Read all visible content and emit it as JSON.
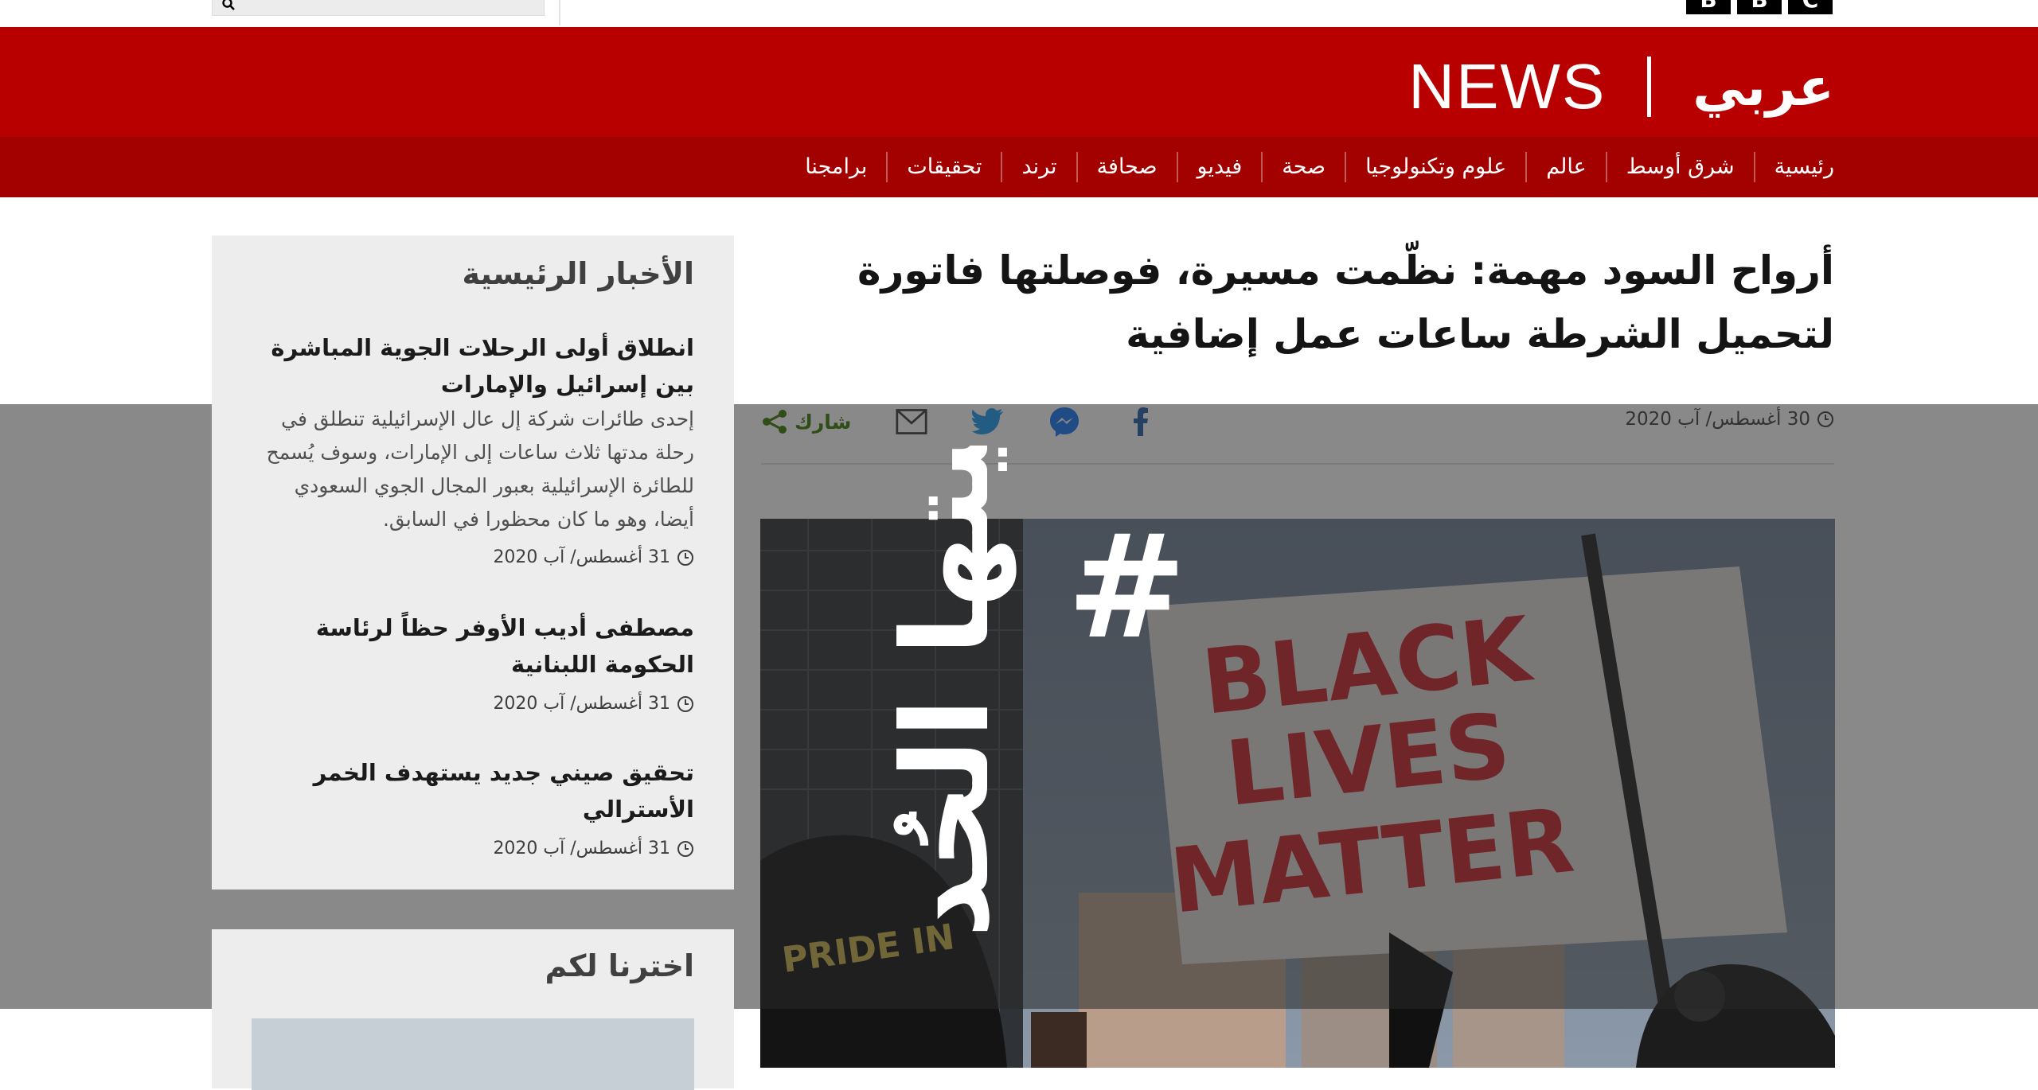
{
  "brand": {
    "news": "NEWS",
    "arabic": "عربي"
  },
  "topbar": {
    "logo_letters": [
      "B",
      "B",
      "C"
    ]
  },
  "nav": {
    "items": [
      "رئيسية",
      "شرق أوسط",
      "عالم",
      "علوم وتكنولوجيا",
      "صحة",
      "فيديو",
      "صحافة",
      "ترند",
      "تحقيقات",
      "برامجنا"
    ]
  },
  "article": {
    "headline": "أرواح السود مهمة: نظّمت مسيرة، فوصلتها فاتورة لتحميل الشرطة ساعات عمل إضافية",
    "date": "30 أغسطس/ آب 2020",
    "share_label": "شارك",
    "share_icons": [
      "facebook-icon",
      "messenger-icon",
      "twitter-icon",
      "email-icon"
    ]
  },
  "hero": {
    "sign_lines": [
      "BLACK",
      "LIVES",
      "MATTER"
    ],
    "hashtag_mark": "#",
    "calligraphy": "ليتها الحُدود",
    "shirt_text": "PRIDE IN"
  },
  "sidebar": {
    "title": "الأخبار الرئيسية",
    "items": [
      {
        "headline": "انطلاق أولى الرحلات الجوية المباشرة بين إسرائيل والإمارات",
        "summary": "إحدى طائرات شركة إل عال الإسرائيلية تنطلق في رحلة مدتها ثلاث ساعات إلى الإمارات، وسوف يُسمح للطائرة الإسرائيلية بعبور المجال الجوي السعودي أيضا، وهو ما كان محظورا في السابق.",
        "date": "31 أغسطس/ آب 2020"
      },
      {
        "headline": "مصطفى أديب الأوفر حظاً لرئاسة الحكومة اللبنانية",
        "summary": "",
        "date": "31 أغسطس/ آب 2020"
      },
      {
        "headline": "تحقيق صيني جديد يستهدف الخمر الأسترالي",
        "summary": "",
        "date": "31 أغسطس/ آب 2020"
      }
    ]
  },
  "sidebar2": {
    "title": "اخترنا لكم"
  },
  "colors": {
    "masthead": "#b80000",
    "nav": "#a30000",
    "share_green": "#397a00",
    "sign_red": "#c8242c"
  }
}
